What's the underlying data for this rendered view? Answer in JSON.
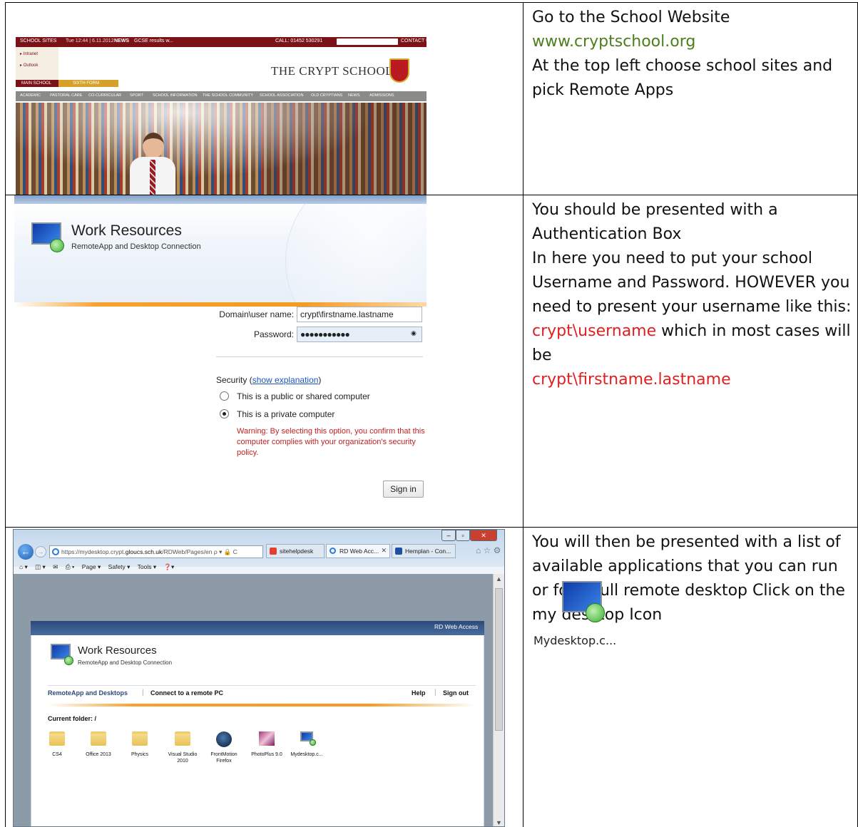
{
  "rows": [
    {
      "instructions": {
        "line1": "Go to the School Website",
        "url": "www.cryptschool.org",
        "line2": "At the top left choose school sites and pick Remote Apps"
      },
      "website": {
        "school_sites": "SCHOOL SITES",
        "datetime": "Tue 12:44 | 6.11.2012",
        "news_tag": "NEWS",
        "news_text": "GCSE results w...",
        "call": "CALL: 01452 530291",
        "contact": "CONTACT US",
        "menu": [
          "Intranet",
          "Outlook"
        ],
        "main_school": "MAIN SCHOOL",
        "sixth_form": "SIXTH FORM",
        "title": "THE CRYPT SCHOOL",
        "nav": [
          "ACADEMIC",
          "PASTORAL CARE",
          "CO-CURRICULAR",
          "SPORT",
          "SCHOOL INFORMATION",
          "THE SCHOOL COMMUNITY",
          "SCHOOL ASSOCIATION",
          "OLD CRYPTIANS",
          "NEWS",
          "ADMISSIONS"
        ],
        "colors": {
          "maroon": "#7a1218",
          "gold": "#d5a12a"
        }
      }
    },
    {
      "instructions": {
        "line1": "You should be presented with a Authentication Box",
        "line2": "In here you need to put your school Username and Password.  HOWEVER you need to present your username like this: ",
        "example": "crypt\\username",
        "line3": " which in most cases will be ",
        "example2": "crypt\\firstname.lastname"
      },
      "login": {
        "title": "Work Resources",
        "subtitle": "RemoteApp and Desktop Connection",
        "user_label": "Domain\\user name:",
        "user_value": "crypt\\firstname.lastname",
        "password_label": "Password:",
        "password_value": "●●●●●●●●●●●",
        "security_label": "Security (",
        "security_link": "show explanation",
        "security_close": ")",
        "option_public": "This is a public or shared computer",
        "option_private": "This is a private computer",
        "selected": "private",
        "warning": "Warning: By selecting this option, you confirm that this computer complies with your organization's security policy.",
        "sign_in": "Sign in",
        "colors": {
          "accent": "#f59a22",
          "warning": "#c42020"
        }
      }
    },
    {
      "instructions": {
        "line1": "You will then be presented with a list of available applications that you can run or for a full remote desktop Click on the my desktop Icon",
        "icon_label": "Mydesktop.c..."
      },
      "browser": {
        "address": "https://mydesktop.crypt.",
        "address_bold": "gloucs.sch.uk",
        "address_rest": "/RDWeb/Pages/en",
        "address_tools": "ρ ▾ 🔒 C",
        "tabs": [
          "sitehelpdesk",
          "RD Web Acc...",
          "Hemplan - Con..."
        ],
        "commands": [
          "Page ▾",
          "Safety ▾",
          "Tools ▾"
        ],
        "rd_web_access": "RD Web Access",
        "title": "Work Resources",
        "subtitle": "RemoteApp and Desktop Connection",
        "nav_remoteapp": "RemoteApp and Desktops",
        "nav_connect": "Connect to a remote PC",
        "help": "Help",
        "sign_out": "Sign out",
        "current_folder": "Current folder: /",
        "apps": [
          "CS4",
          "Office 2013",
          "Physics",
          "Visual Studio 2010",
          "FrontMotion Firefox",
          "PhotoPlus 9.0",
          "Mydesktop.c..."
        ]
      }
    }
  ]
}
